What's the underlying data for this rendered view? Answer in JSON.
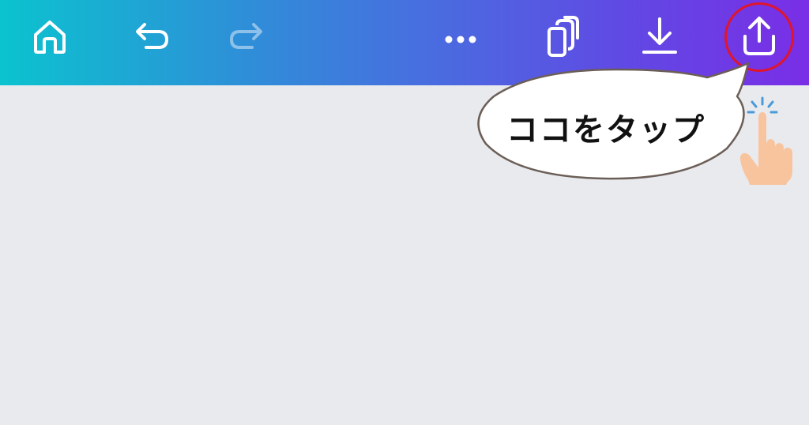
{
  "toolbar": {
    "buttons": [
      {
        "name": "home-button",
        "icon": "home-icon"
      },
      {
        "name": "undo-button",
        "icon": "undo-icon"
      },
      {
        "name": "redo-button",
        "icon": "redo-icon",
        "disabled": true
      },
      {
        "name": "more-button",
        "icon": "more-dots-icon"
      },
      {
        "name": "duplicate-button",
        "icon": "pages-icon"
      },
      {
        "name": "download-button",
        "icon": "download-icon"
      },
      {
        "name": "share-button",
        "icon": "share-upload-icon",
        "highlighted": true
      }
    ],
    "gradient": [
      "#0bc3cf",
      "#7a2ee6"
    ]
  },
  "callout": {
    "text": "ココをタップ"
  },
  "colors": {
    "highlight_ring": "#e0152a",
    "canvas_background": "#e9eaee",
    "tap_indicator": "#4a9bd8",
    "hand": "#f8c49e"
  }
}
